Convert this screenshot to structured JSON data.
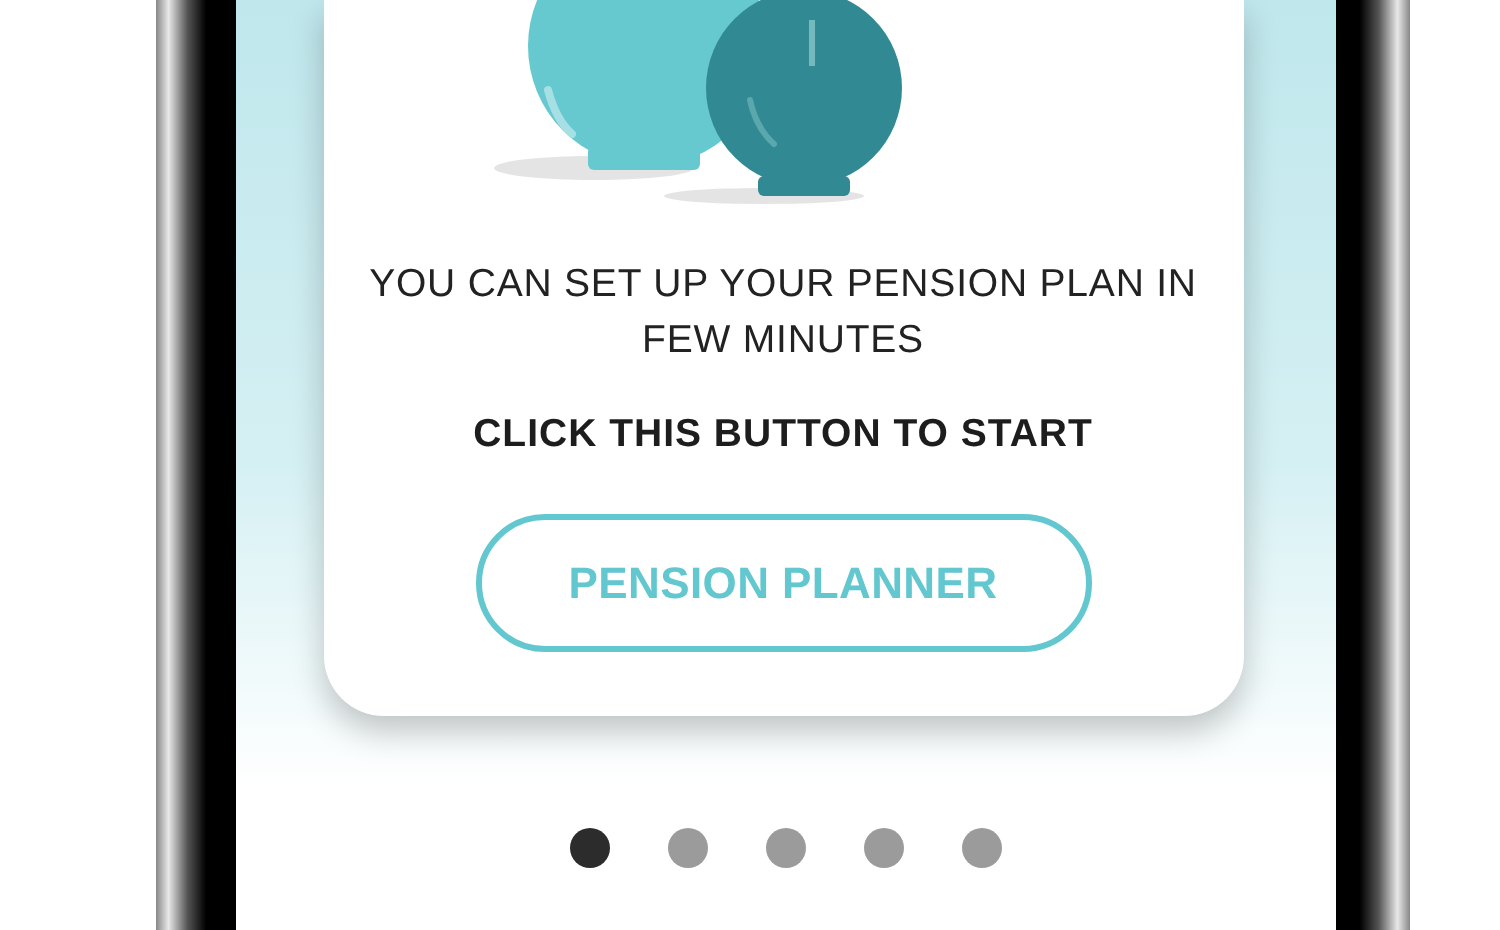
{
  "card": {
    "message": "YOU CAN SET UP YOUR PENSION PLAN IN FEW MINUTES",
    "instruction": "CLICK THIS BUTTON TO START",
    "button": "PENSION PLANNER"
  },
  "pager": [
    {
      "selected": true
    },
    {
      "selected": false
    },
    {
      "selected": false
    },
    {
      "selected": false
    },
    {
      "selected": false
    }
  ]
}
